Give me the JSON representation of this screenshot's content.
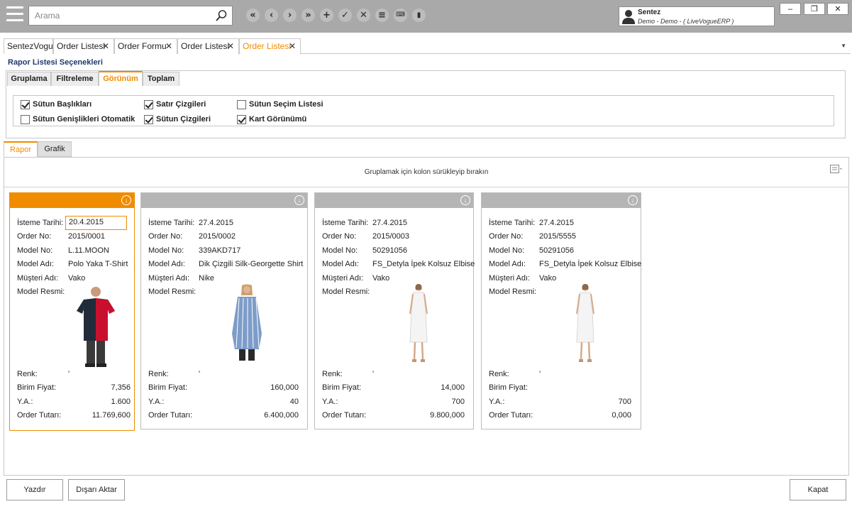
{
  "search": {
    "placeholder": "Arama"
  },
  "toolbar": {
    "icons": [
      "first-icon",
      "previous-icon",
      "next-icon",
      "last-icon",
      "add-icon",
      "save-check-icon",
      "delete-x-icon",
      "list-icon",
      "keyboard-icon",
      "trash-icon"
    ]
  },
  "user": {
    "name": "Sentez",
    "context": "Demo - Demo - ( LiveVogueERP )"
  },
  "window": {
    "minimize": "‒",
    "restore": "❐",
    "close": "✕"
  },
  "doc_tabs": [
    {
      "label": "SentezVogue",
      "closable": false
    },
    {
      "label": "Order Listesi",
      "closable": true
    },
    {
      "label": "Order Formu",
      "closable": true
    },
    {
      "label": "Order Listesi",
      "closable": true
    },
    {
      "label": "Order Listesi",
      "closable": true,
      "active": true
    }
  ],
  "options": {
    "title": "Rapor Listesi Seçenekleri",
    "tabs": [
      "Gruplama",
      "Filtreleme",
      "Görünüm",
      "Toplam"
    ],
    "active_tab": "Görünüm",
    "checkboxes": [
      {
        "label": "Sütun Başlıkları",
        "checked": true
      },
      {
        "label": "Sütun Genişlikleri Otomatik",
        "checked": false
      },
      {
        "label": "Satır Çizgileri",
        "checked": true
      },
      {
        "label": "Sütun Çizgileri",
        "checked": true
      },
      {
        "label": "Sütun Seçim Listesi",
        "checked": false
      },
      {
        "label": "Kart Görünümü",
        "checked": true
      }
    ]
  },
  "view_tabs": [
    "Rapor",
    "Grafik"
  ],
  "group_hint": "Gruplamak için kolon sürükleyip bırakın",
  "labels": {
    "date": "İsteme Tarihi:",
    "order_no": "Order No:",
    "model_no": "Model No:",
    "model_name": "Model Adı:",
    "customer": "Müşteri Adı:",
    "image": "Model Resmi:",
    "color": "Renk:",
    "unit_price": "Birim Fiyat:",
    "qty": "Y.A.:",
    "total": "Order Tutarı:"
  },
  "cards": [
    {
      "date": "20.4.2015",
      "order_no": "2015/0001",
      "model_no": "L.11.MOON",
      "model_name": "Polo Yaka T-Shirt",
      "customer": "Vako",
      "color": "'",
      "unit_price": "7,356",
      "qty": "1.600",
      "total": "11.769,600",
      "image": "polo-shirt-photo"
    },
    {
      "date": "27.4.2015",
      "order_no": "2015/0002",
      "model_no": "339AKD717",
      "model_name": "Dik Çizgili Silk-Georgette Shirt",
      "customer": "Nike",
      "color": "'",
      "unit_price": "160,000",
      "qty": "40",
      "total": "6.400,000",
      "image": "striped-shirt-photo"
    },
    {
      "date": "27.4.2015",
      "order_no": "2015/0003",
      "model_no": "50291056",
      "model_name": "FS_Detyla İpek Kolsuz Elbise",
      "customer": "Vako",
      "color": "'",
      "unit_price": "14,000",
      "qty": "700",
      "total": "9.800,000",
      "image": "white-dress-photo"
    },
    {
      "date": "27.4.2015",
      "order_no": "2015/5555",
      "model_no": "50291056",
      "model_name": "FS_Detyla İpek Kolsuz Elbise",
      "customer": "Vako",
      "color": "'",
      "unit_price": "",
      "qty": "700",
      "total": "0,000",
      "image": "white-dress-photo"
    }
  ],
  "buttons": {
    "print": "Yazdır",
    "export": "Dışarı Aktar",
    "close": "Kapat"
  },
  "colors": {
    "accent": "#f08c00",
    "titlebar": "#a9a9a9",
    "link": "#1e3a6e"
  }
}
